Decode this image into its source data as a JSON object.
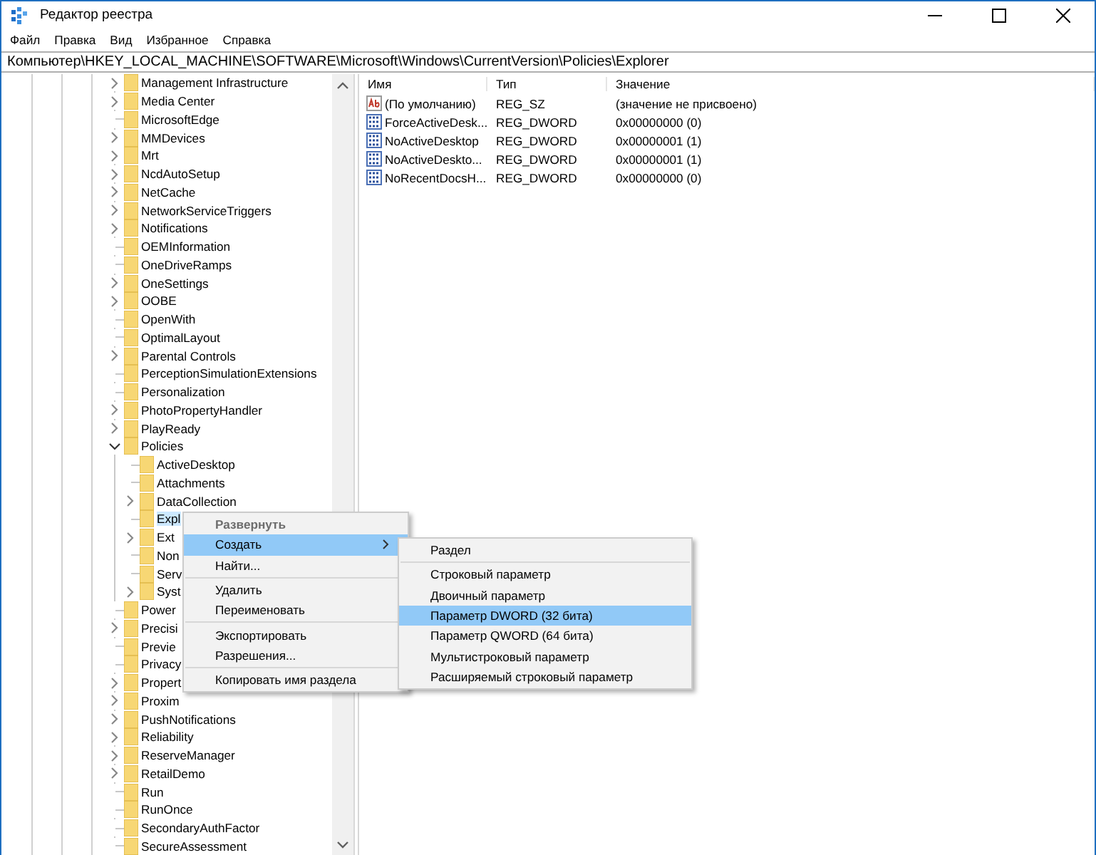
{
  "window": {
    "title": "Редактор реестра"
  },
  "menu_bar": [
    "Файл",
    "Правка",
    "Вид",
    "Избранное",
    "Справка"
  ],
  "address": "Компьютер\\HKEY_LOCAL_MACHINE\\SOFTWARE\\Microsoft\\Windows\\CurrentVersion\\Policies\\Explorer",
  "tree": [
    {
      "label": "Management Infrastructure",
      "kind": "branch",
      "expanded": false,
      "selected": false
    },
    {
      "label": "Media Center",
      "kind": "branch",
      "expanded": false,
      "selected": false
    },
    {
      "label": "MicrosoftEdge",
      "kind": "leaf",
      "selected": false
    },
    {
      "label": "MMDevices",
      "kind": "branch",
      "expanded": false,
      "selected": false
    },
    {
      "label": "Mrt",
      "kind": "branch",
      "expanded": false,
      "selected": false
    },
    {
      "label": "NcdAutoSetup",
      "kind": "branch",
      "expanded": false,
      "selected": false
    },
    {
      "label": "NetCache",
      "kind": "branch",
      "expanded": false,
      "selected": false
    },
    {
      "label": "NetworkServiceTriggers",
      "kind": "branch",
      "expanded": false,
      "selected": false
    },
    {
      "label": "Notifications",
      "kind": "branch",
      "expanded": false,
      "selected": false
    },
    {
      "label": "OEMInformation",
      "kind": "leaf",
      "selected": false
    },
    {
      "label": "OneDriveRamps",
      "kind": "leaf",
      "selected": false
    },
    {
      "label": "OneSettings",
      "kind": "branch",
      "expanded": false,
      "selected": false
    },
    {
      "label": "OOBE",
      "kind": "branch",
      "expanded": false,
      "selected": false
    },
    {
      "label": "OpenWith",
      "kind": "leaf",
      "selected": false
    },
    {
      "label": "OptimalLayout",
      "kind": "leaf",
      "selected": false
    },
    {
      "label": "Parental Controls",
      "kind": "branch",
      "expanded": false,
      "selected": false
    },
    {
      "label": "PerceptionSimulationExtensions",
      "kind": "leaf",
      "selected": false
    },
    {
      "label": "Personalization",
      "kind": "leaf",
      "selected": false
    },
    {
      "label": "PhotoPropertyHandler",
      "kind": "branch",
      "expanded": false,
      "selected": false
    },
    {
      "label": "PlayReady",
      "kind": "branch",
      "expanded": false,
      "selected": false
    },
    {
      "label": "Policies",
      "kind": "branch",
      "expanded": true,
      "selected": false,
      "children": [
        {
          "label": "ActiveDesktop",
          "kind": "leaf",
          "selected": false
        },
        {
          "label": "Attachments",
          "kind": "leaf",
          "selected": false
        },
        {
          "label": "DataCollection",
          "kind": "branch",
          "expanded": false,
          "selected": false
        },
        {
          "label": "Expl",
          "kind": "leaf",
          "selected": true
        },
        {
          "label": "Ext",
          "kind": "branch",
          "expanded": false,
          "selected": false
        },
        {
          "label": "Non",
          "kind": "leaf",
          "selected": false
        },
        {
          "label": "Serv",
          "kind": "leaf",
          "selected": false
        },
        {
          "label": "Syst",
          "kind": "branch",
          "expanded": false,
          "selected": false
        }
      ]
    },
    {
      "label": "Power",
      "kind": "leaf",
      "selected": false
    },
    {
      "label": "Precisi",
      "kind": "branch",
      "expanded": false,
      "selected": false
    },
    {
      "label": "Previe",
      "kind": "leaf",
      "selected": false
    },
    {
      "label": "Privacy",
      "kind": "leaf",
      "selected": false
    },
    {
      "label": "Propert",
      "kind": "branch",
      "expanded": false,
      "selected": false
    },
    {
      "label": "Proxim",
      "kind": "branch",
      "expanded": false,
      "selected": false
    },
    {
      "label": "PushNotifications",
      "kind": "branch",
      "expanded": false,
      "selected": false
    },
    {
      "label": "Reliability",
      "kind": "branch",
      "expanded": false,
      "selected": false
    },
    {
      "label": "ReserveManager",
      "kind": "branch",
      "expanded": false,
      "selected": false
    },
    {
      "label": "RetailDemo",
      "kind": "branch",
      "expanded": false,
      "selected": false
    },
    {
      "label": "Run",
      "kind": "leaf",
      "selected": false
    },
    {
      "label": "RunOnce",
      "kind": "leaf",
      "selected": false
    },
    {
      "label": "SecondaryAuthFactor",
      "kind": "leaf",
      "selected": false
    },
    {
      "label": "SecureAssessment",
      "kind": "leaf",
      "selected": false
    }
  ],
  "values_table": {
    "columns": [
      "Имя",
      "Тип",
      "Значение"
    ],
    "rows": [
      {
        "kind": "string",
        "name": "(По умолчанию)",
        "type": "REG_SZ",
        "value": "(значение не присвоено)"
      },
      {
        "kind": "dword",
        "name": "ForceActiveDesk...",
        "type": "REG_DWORD",
        "value": "0x00000000 (0)"
      },
      {
        "kind": "dword",
        "name": "NoActiveDesktop",
        "type": "REG_DWORD",
        "value": "0x00000001 (1)"
      },
      {
        "kind": "dword",
        "name": "NoActiveDeskto...",
        "type": "REG_DWORD",
        "value": "0x00000001 (1)"
      },
      {
        "kind": "dword",
        "name": "NoRecentDocsH...",
        "type": "REG_DWORD",
        "value": "0x00000000 (0)"
      }
    ]
  },
  "context_menu": [
    {
      "kind": "item",
      "label": "Развернуть",
      "default": true,
      "disabled": true,
      "selected": false
    },
    {
      "kind": "submenu",
      "label": "Создать",
      "default": false,
      "disabled": false,
      "selected": true
    },
    {
      "kind": "item",
      "label": "Найти...",
      "default": false,
      "disabled": false,
      "selected": false
    },
    {
      "kind": "separator"
    },
    {
      "kind": "item",
      "label": "Удалить",
      "default": false,
      "disabled": false,
      "selected": false
    },
    {
      "kind": "item",
      "label": "Переименовать",
      "default": false,
      "disabled": false,
      "selected": false
    },
    {
      "kind": "separator"
    },
    {
      "kind": "item",
      "label": "Экспортировать",
      "default": false,
      "disabled": false,
      "selected": false
    },
    {
      "kind": "item",
      "label": "Разрешения...",
      "default": false,
      "disabled": false,
      "selected": false
    },
    {
      "kind": "separator"
    },
    {
      "kind": "item",
      "label": "Копировать имя раздела",
      "default": false,
      "disabled": false,
      "selected": false
    }
  ],
  "submenu": [
    {
      "kind": "item",
      "label": "Раздел",
      "default": false,
      "disabled": false,
      "selected": false
    },
    {
      "kind": "separator"
    },
    {
      "kind": "item",
      "label": "Строковый параметр",
      "default": false,
      "disabled": false,
      "selected": false
    },
    {
      "kind": "item",
      "label": "Двоичный параметр",
      "default": false,
      "disabled": false,
      "selected": false
    },
    {
      "kind": "item",
      "label": "Параметр DWORD (32 бита)",
      "default": false,
      "disabled": false,
      "selected": true
    },
    {
      "kind": "item",
      "label": "Параметр QWORD (64 бита)",
      "default": false,
      "disabled": false,
      "selected": false
    },
    {
      "kind": "item",
      "label": "Мультистроковый параметр",
      "default": false,
      "disabled": false,
      "selected": false
    },
    {
      "kind": "item",
      "label": "Расширяемый строковый параметр",
      "default": false,
      "disabled": false,
      "selected": false
    }
  ]
}
